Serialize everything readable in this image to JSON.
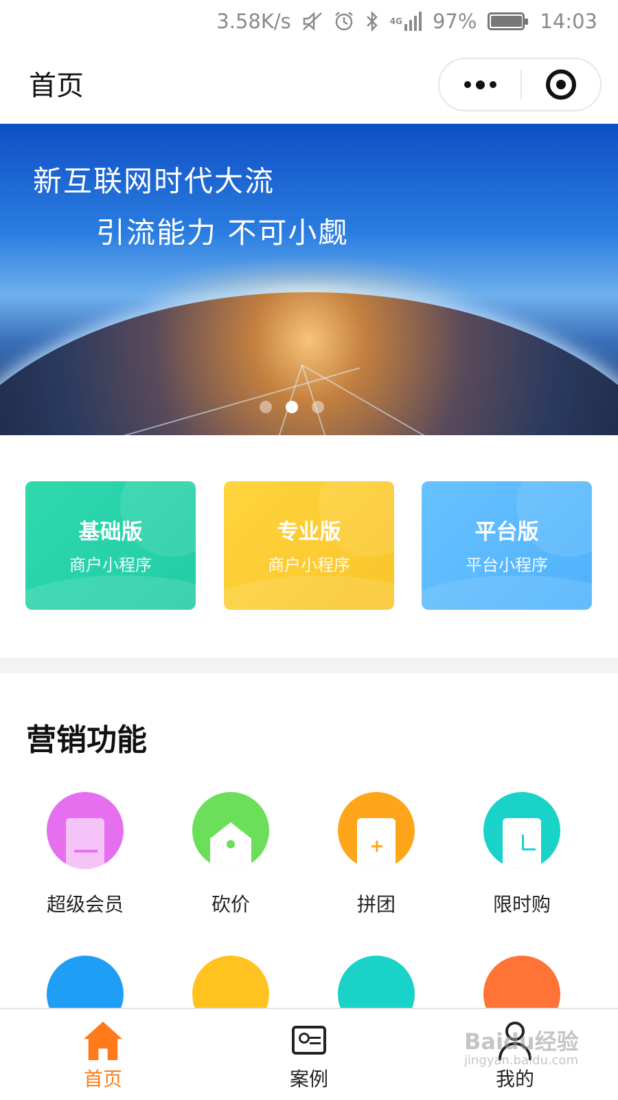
{
  "status_bar": {
    "speed": "3.58K/s",
    "network": "4G",
    "battery": "97%",
    "battery_level": 0.97,
    "time": "14:03",
    "icons": [
      "mute-icon",
      "alarm-icon",
      "bluetooth-icon",
      "signal-icon",
      "battery-icon"
    ]
  },
  "nav": {
    "title": "首页",
    "more_icon": "more-dots-icon",
    "close_icon": "target-close-icon"
  },
  "banner": {
    "line1": "新互联网时代大流",
    "line2": "引流能力 不可小觑",
    "slide_count": 3,
    "active_slide": 2
  },
  "cards": [
    {
      "title": "基础版",
      "subtitle": "商户小程序",
      "color": "#22cca6"
    },
    {
      "title": "专业版",
      "subtitle": "商户小程序",
      "color": "#f9c52a"
    },
    {
      "title": "平台版",
      "subtitle": "平台小程序",
      "color": "#4fb1fb"
    }
  ],
  "section": {
    "title": "营销功能"
  },
  "features": [
    {
      "label": "超级会员",
      "icon": "crown-card-icon",
      "color": "#e66ff0"
    },
    {
      "label": "砍价",
      "icon": "house-tag-icon",
      "color": "#6bdf5a"
    },
    {
      "label": "拼团",
      "icon": "shopping-bag-icon",
      "color": "#ffa51a"
    },
    {
      "label": "限时购",
      "icon": "clock-icon",
      "color": "#19d3c8"
    }
  ],
  "tabs": [
    {
      "label": "首页",
      "icon": "home-icon",
      "active": true
    },
    {
      "label": "案例",
      "icon": "case-card-icon",
      "active": false
    },
    {
      "label": "我的",
      "icon": "user-icon",
      "active": false
    }
  ],
  "watermark": {
    "brand": "Baidu经验",
    "domain": "jingyan.baidu.com"
  },
  "colors": {
    "accent": "#ff7a1a",
    "text": "#222222"
  }
}
